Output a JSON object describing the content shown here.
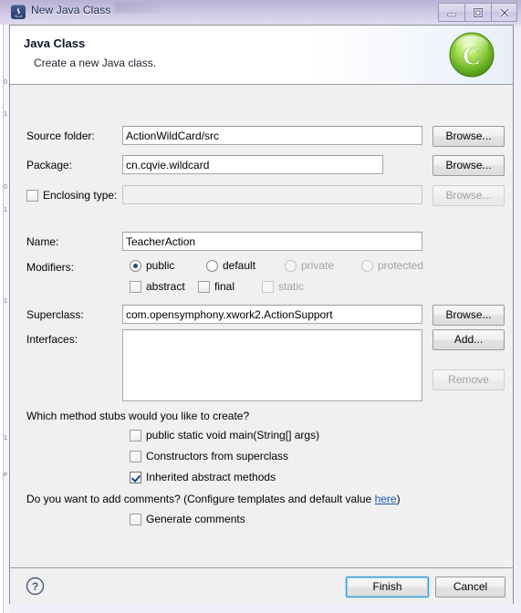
{
  "window": {
    "title": "New Java Class",
    "icon": "java-class-icon",
    "controls": [
      {
        "name": "minimize-button",
        "glyph": "minimize"
      },
      {
        "name": "restore-button",
        "glyph": "restore"
      },
      {
        "name": "close-button",
        "glyph": "close"
      }
    ]
  },
  "header": {
    "title": "Java Class",
    "subtitle": "Create a new Java class.",
    "icon": "green-class-wizard-icon",
    "icon_letter": "C",
    "accent_color": "#7bc62d"
  },
  "form": {
    "source_folder": {
      "label": "Source folder:",
      "value": "ActionWildCard/src",
      "placeholder": "",
      "browse_label": "Browse...",
      "browse_enabled": true
    },
    "package": {
      "label": "Package:",
      "value": "cn.cqvie.wildcard",
      "placeholder": "",
      "browse_label": "Browse...",
      "browse_enabled": true
    },
    "enclosing_type": {
      "label": "Enclosing type:",
      "checked": false,
      "value": "",
      "placeholder": "",
      "browse_label": "Browse...",
      "browse_enabled": false
    },
    "name": {
      "label": "Name:",
      "value": "TeacherAction",
      "placeholder": ""
    },
    "modifiers": {
      "label": "Modifiers:",
      "radios": [
        {
          "label": "public",
          "selected": true,
          "enabled": true
        },
        {
          "label": "default",
          "selected": false,
          "enabled": true
        },
        {
          "label": "private",
          "selected": false,
          "enabled": false
        },
        {
          "label": "protected",
          "selected": false,
          "enabled": false
        }
      ],
      "checkboxes": [
        {
          "label": "abstract",
          "checked": false,
          "enabled": true
        },
        {
          "label": "final",
          "checked": false,
          "enabled": true
        },
        {
          "label": "static",
          "checked": false,
          "enabled": false
        }
      ]
    },
    "superclass": {
      "label": "Superclass:",
      "value": "com.opensymphony.xwork2.ActionSupport",
      "placeholder": "",
      "browse_label": "Browse...",
      "browse_enabled": true
    },
    "interfaces": {
      "label": "Interfaces:",
      "items": [],
      "add_label": "Add...",
      "add_enabled": true,
      "remove_label": "Remove",
      "remove_enabled": false
    }
  },
  "stubs": {
    "question": "Which method stubs would you like to create?",
    "options": [
      {
        "label": "public static void main(String[] args)",
        "checked": false,
        "enabled": true
      },
      {
        "label": "Constructors from superclass",
        "checked": false,
        "enabled": true
      },
      {
        "label": "Inherited abstract methods",
        "checked": true,
        "enabled": true
      }
    ]
  },
  "comments": {
    "question_before": "Do you want to add comments? (Configure templates and default value ",
    "link": "here",
    "question_after": ")",
    "option": {
      "label": "Generate comments",
      "checked": false,
      "enabled": true
    }
  },
  "footer": {
    "help_label": "?",
    "finish_label": "Finish",
    "cancel_label": "Cancel"
  }
}
